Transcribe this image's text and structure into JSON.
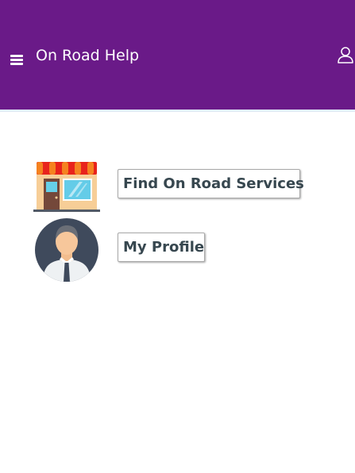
{
  "header": {
    "title": "On Road Help",
    "menu_icon": "hamburger-menu-icon",
    "user_icon": "user-outline-icon",
    "background_color": "#6a1a88"
  },
  "main": {
    "items": [
      {
        "icon": "shop-storefront-icon",
        "label": "Find On Road Services"
      },
      {
        "icon": "user-avatar-icon",
        "label": "My Profile"
      }
    ]
  }
}
